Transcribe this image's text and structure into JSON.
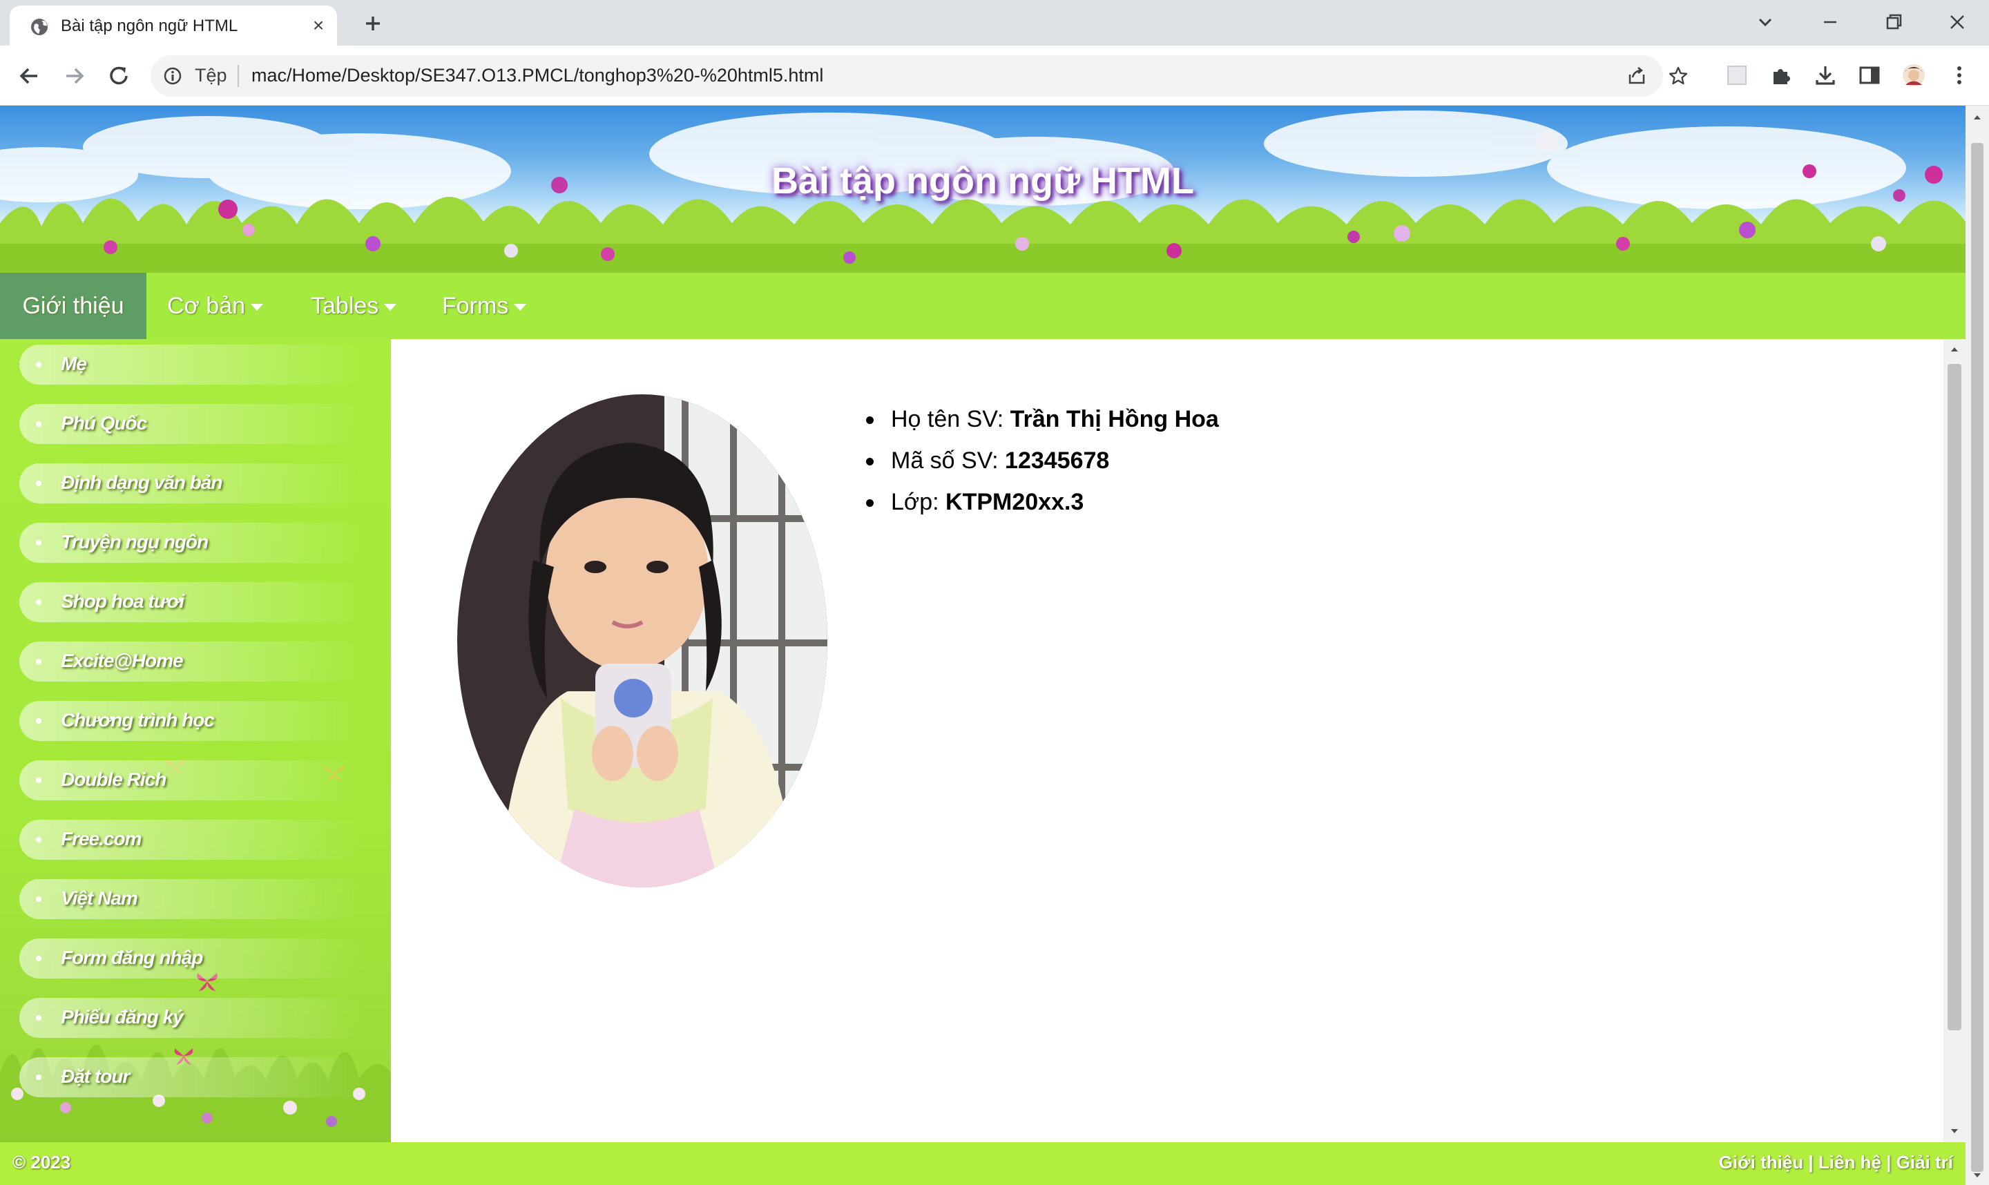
{
  "browser": {
    "tab_title": "Bài tập ngôn ngữ HTML",
    "site_label": "Tệp",
    "url": "mac/Home/Desktop/SE347.O13.PMCL/tonghop3%20-%20html5.html"
  },
  "page": {
    "banner_title": "Bài tập ngôn ngữ HTML",
    "menu": {
      "intro": "Giới thiệu",
      "basic": "Cơ bản",
      "tables": "Tables",
      "forms": "Forms"
    },
    "sidebar": [
      "Mẹ",
      "Phú Quốc",
      "Định dạng văn bản",
      "Truyện ngụ ngôn",
      "Shop hoa tươi",
      "Excite@Home",
      "Chương trình học",
      "Double Rich",
      "Free.com",
      "Việt Nam",
      "Form đăng nhập",
      "Phiếu đăng ký",
      "Đặt tour"
    ],
    "student": {
      "name_label": "Họ tên SV:",
      "name_value": "Trần Thị Hồng Hoa",
      "id_label": "Mã số SV:",
      "id_value": "12345678",
      "class_label": "Lớp:",
      "class_value": "KTPM20xx.3"
    },
    "footer": {
      "copyright": "© 2023",
      "links": [
        "Giới thiệu",
        "Liên hệ",
        "Giải trí"
      ],
      "separator": " | "
    }
  },
  "colors": {
    "menu_bar": "#a5eb3f",
    "menu_active": "#5e9e66",
    "sidebar": "#a9ec3e",
    "footer": "#b2ee3e"
  },
  "icons": [
    "globe-icon",
    "close-icon",
    "plus-icon",
    "back-icon",
    "forward-icon",
    "reload-icon",
    "info-icon",
    "share-icon",
    "star-icon",
    "extensions-icon",
    "download-icon",
    "side-panel-icon",
    "menu-icon"
  ]
}
